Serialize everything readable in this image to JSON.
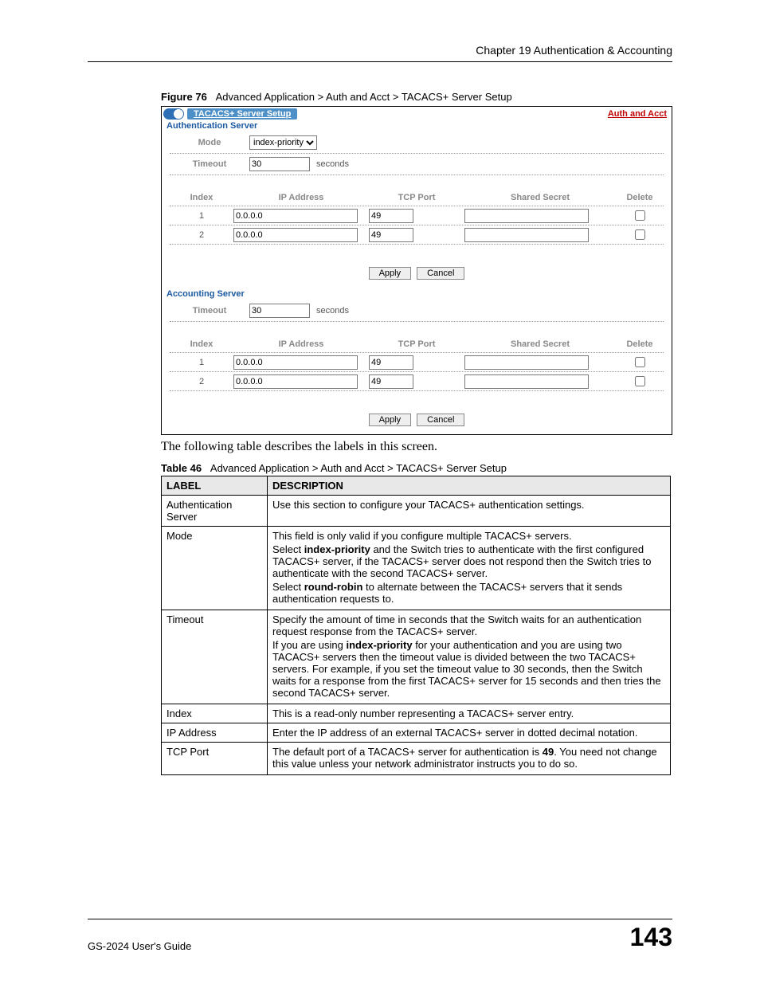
{
  "chapter": "Chapter 19 Authentication & Accounting",
  "figure": {
    "prefix": "Figure 76",
    "caption": "Advanced Application > Auth and Acct > TACACS+ Server Setup"
  },
  "screenshot": {
    "title": "TACACS+ Server Setup",
    "link": "Auth and Acct",
    "auth_section": "Authentication Server",
    "mode_label": "Mode",
    "mode_value": "index-priority",
    "timeout_label": "Timeout",
    "timeout_value": "30",
    "timeout_unit": "seconds",
    "columns": {
      "index": "Index",
      "ip": "IP Address",
      "port": "TCP Port",
      "secret": "Shared Secret",
      "delete": "Delete"
    },
    "auth_rows": [
      {
        "index": "1",
        "ip": "0.0.0.0",
        "port": "49",
        "secret": ""
      },
      {
        "index": "2",
        "ip": "0.0.0.0",
        "port": "49",
        "secret": ""
      }
    ],
    "apply": "Apply",
    "cancel": "Cancel",
    "acct_section": "Accounting Server",
    "acct_timeout_value": "30",
    "acct_rows": [
      {
        "index": "1",
        "ip": "0.0.0.0",
        "port": "49",
        "secret": ""
      },
      {
        "index": "2",
        "ip": "0.0.0.0",
        "port": "49",
        "secret": ""
      }
    ]
  },
  "intro": "The following table describes the labels in this screen.",
  "table": {
    "prefix": "Table 46",
    "caption": "Advanced Application > Auth and Acct > TACACS+ Server Setup",
    "head_label": "LABEL",
    "head_desc": "DESCRIPTION",
    "rows": {
      "r1_label": "Authentication Server",
      "r1_desc": "Use this section to configure your TACACS+ authentication settings.",
      "r2_label": "Mode",
      "r2_p1": "This field is only valid if you configure multiple TACACS+ servers.",
      "r2_p2a": "Select ",
      "r2_p2b": "index-priority",
      "r2_p2c": " and the Switch tries to authenticate with the first configured TACACS+ server, if the TACACS+ server does not respond then the Switch tries to authenticate with the second TACACS+ server.",
      "r2_p3a": "Select ",
      "r2_p3b": "round-robin",
      "r2_p3c": " to alternate between the TACACS+ servers that it sends authentication requests to.",
      "r3_label": "Timeout",
      "r3_p1": "Specify the amount of time in seconds that the Switch waits for an authentication request response from the TACACS+ server.",
      "r3_p2a": "If you are using ",
      "r3_p2b": "index-priority",
      "r3_p2c": " for your authentication and you are using two TACACS+ servers then the timeout value is divided between the two TACACS+ servers. For example, if you set the timeout value to 30 seconds, then the Switch waits for a response from the first TACACS+ server for 15 seconds and then tries the second TACACS+ server.",
      "r4_label": "Index",
      "r4_desc": "This is a read-only number representing a TACACS+ server entry.",
      "r5_label": "IP Address",
      "r5_desc": "Enter the IP address of an external TACACS+ server in dotted decimal notation.",
      "r6_label": "TCP Port",
      "r6_p1a": "The default port of a TACACS+ server for authentication is ",
      "r6_p1b": "49",
      "r6_p1c": ". You need not change this value unless your network administrator instructs you to do so."
    }
  },
  "footer": {
    "guide": "GS-2024 User's Guide",
    "page": "143"
  }
}
